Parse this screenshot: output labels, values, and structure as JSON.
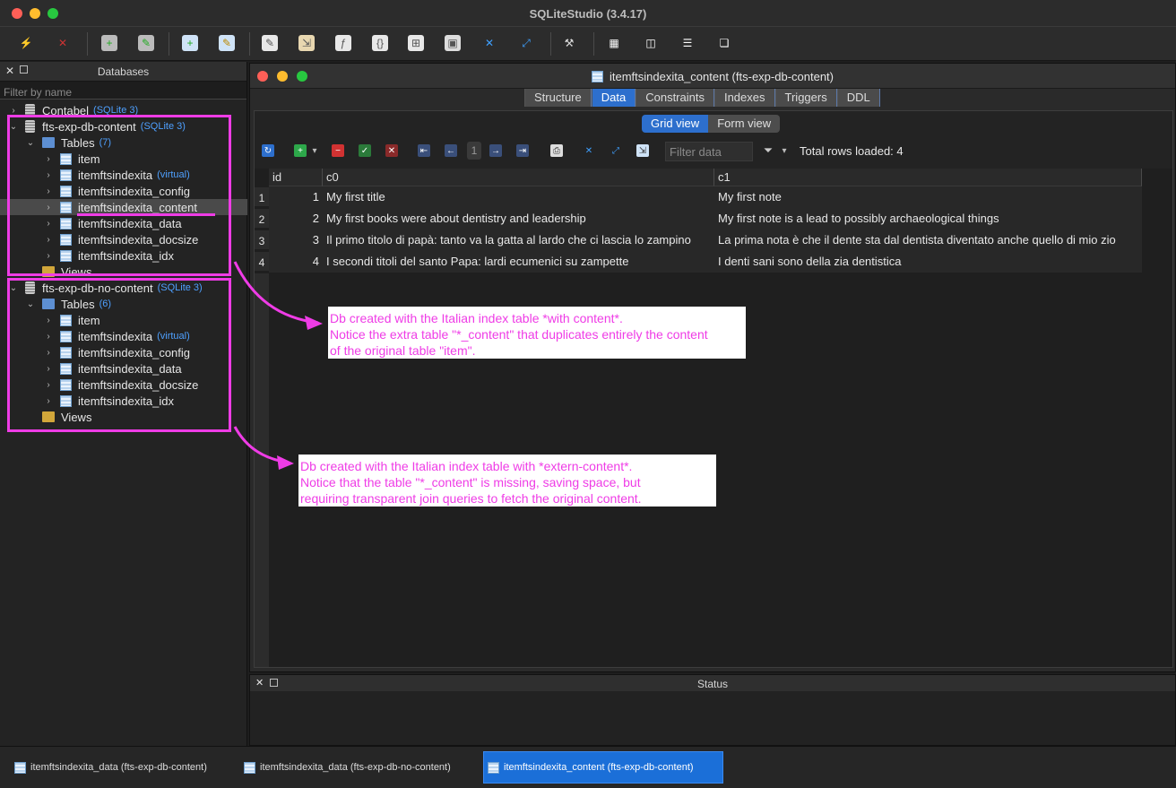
{
  "app": {
    "title": "SQLiteStudio (3.4.17)"
  },
  "db_panel": {
    "title": "Databases",
    "filter_placeholder": "Filter by name",
    "tree": [
      {
        "label": "Contabel",
        "meta": "(SQLite 3)"
      },
      {
        "label": "fts-exp-db-content",
        "meta": "(SQLite 3)"
      },
      {
        "label": "Tables",
        "meta": "(7)"
      },
      {
        "label": "item"
      },
      {
        "label": "itemftsindexita",
        "meta": "(virtual)"
      },
      {
        "label": "itemftsindexita_config"
      },
      {
        "label": "itemftsindexita_content"
      },
      {
        "label": "itemftsindexita_data"
      },
      {
        "label": "itemftsindexita_docsize"
      },
      {
        "label": "itemftsindexita_idx"
      },
      {
        "label": "Views"
      },
      {
        "label": "fts-exp-db-no-content",
        "meta": "(SQLite 3)"
      },
      {
        "label": "Tables",
        "meta": "(6)"
      },
      {
        "label": "item"
      },
      {
        "label": "itemftsindexita",
        "meta": "(virtual)"
      },
      {
        "label": "itemftsindexita_config"
      },
      {
        "label": "itemftsindexita_data"
      },
      {
        "label": "itemftsindexita_docsize"
      },
      {
        "label": "itemftsindexita_idx"
      },
      {
        "label": "Views"
      }
    ]
  },
  "window": {
    "title": "itemftsindexita_content (fts-exp-db-content)",
    "tabs": [
      "Structure",
      "Data",
      "Constraints",
      "Indexes",
      "Triggers",
      "DDL"
    ],
    "active_tab": "Data",
    "views": [
      "Grid view",
      "Form view"
    ],
    "page": "1",
    "filter_placeholder": "Filter data",
    "total_rows": "Total rows loaded: 4",
    "columns": [
      "id",
      "c0",
      "c1"
    ],
    "rows": [
      {
        "n": "1",
        "id": "1",
        "c0": "My first title",
        "c1": "My first note"
      },
      {
        "n": "2",
        "id": "2",
        "c0": "My first books were about dentistry and leadership",
        "c1": "My first note is a lead to possibly archaeological things"
      },
      {
        "n": "3",
        "id": "3",
        "c0": "Il primo titolo di papà: tanto va la gatta al lardo che ci lascia lo zampino",
        "c1": "La prima nota è che il dente sta dal dentista diventato anche quello di mio zio"
      },
      {
        "n": "4",
        "id": "4",
        "c0": "I secondi titoli del santo Papa: lardi ecumenici su zampette",
        "c1": "I denti sani sono della zia dentistica"
      }
    ]
  },
  "status_panel": {
    "title": "Status"
  },
  "taskbar": [
    {
      "label": "itemftsindexita_data (fts-exp-db-content)"
    },
    {
      "label": "itemftsindexita_data (fts-exp-db-no-content)"
    },
    {
      "label": "itemftsindexita_content (fts-exp-db-content)"
    }
  ],
  "annotations": {
    "note1": [
      "Db created with the Italian index table *with content*.",
      "Notice the extra table \"*_content\" that duplicates entirely the content",
      "of the original table \"item\"."
    ],
    "note2": [
      "Db created with the Italian index table with *extern-content*.",
      "Notice that the table \"*_content\" is missing, saving space, but",
      "requiring transparent join queries to fetch the original content."
    ],
    "color": "#ef3ce6"
  }
}
